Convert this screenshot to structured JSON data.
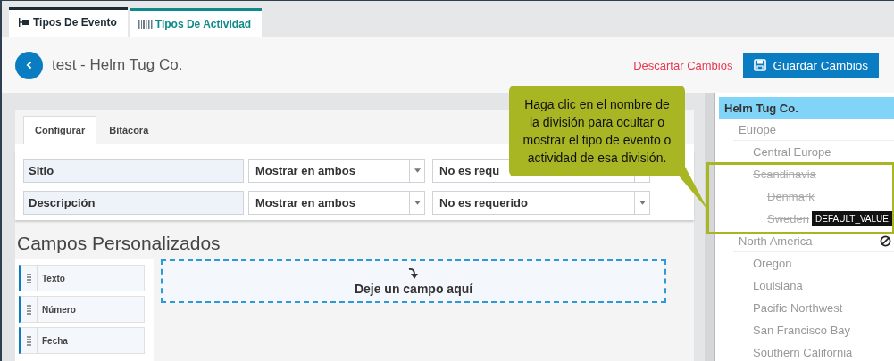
{
  "top_tabs": [
    {
      "label": "Tipos De Evento",
      "kind": "event",
      "selected": true
    },
    {
      "label": "Tipos De Actividad",
      "kind": "activity",
      "selected": false
    }
  ],
  "header": {
    "title": "test - Helm Tug Co.",
    "discard": "Descartar Cambios",
    "save": "Guardar Cambios"
  },
  "inner_tabs": [
    {
      "label": "Configurar",
      "selected": true
    },
    {
      "label": "Bitácora",
      "selected": false
    }
  ],
  "fields": [
    {
      "name": "Sitio",
      "visibility": "Mostrar en ambos",
      "required": "No es requ"
    },
    {
      "name": "Descripción",
      "visibility": "Mostrar en ambos",
      "required": "No es requerido"
    }
  ],
  "custom_fields": {
    "title": "Campos Personalizados",
    "palette": [
      "Texto",
      "Número",
      "Fecha"
    ],
    "drop_zone": "Deje un campo aquí"
  },
  "tree": [
    {
      "name": "Helm Tug Co.",
      "selected": true,
      "hidden": false,
      "hovered": false,
      "children": [
        {
          "name": "Europe",
          "selected": false,
          "hidden": false,
          "hovered": false,
          "children": [
            {
              "name": "Central Europe",
              "selected": false,
              "hidden": false,
              "hovered": false
            },
            {
              "name": "Scandinavia",
              "selected": false,
              "hidden": true,
              "hovered": false,
              "children": [
                {
                  "name": "Denmark",
                  "selected": false,
                  "hidden": true,
                  "hovered": false
                },
                {
                  "name": "Sweden",
                  "selected": false,
                  "hidden": true,
                  "hovered": false
                }
              ]
            }
          ]
        },
        {
          "name": "North America",
          "selected": false,
          "hidden": false,
          "hovered": true,
          "children": [
            {
              "name": "Oregon",
              "selected": false,
              "hidden": false,
              "hovered": false
            },
            {
              "name": "Louisiana",
              "selected": false,
              "hidden": false,
              "hovered": false
            },
            {
              "name": "Pacific Northwest",
              "selected": false,
              "hidden": false,
              "hovered": false
            },
            {
              "name": "San Francisco Bay",
              "selected": false,
              "hidden": false,
              "hovered": false
            },
            {
              "name": "Southern California",
              "selected": false,
              "hidden": false,
              "hovered": false
            }
          ]
        }
      ]
    }
  ],
  "tooltip": "DEFAULT_VALUE",
  "callout": "Haga clic en el nombre de la división para ocultar o mostrar el tipo de evento o actividad de esa división."
}
